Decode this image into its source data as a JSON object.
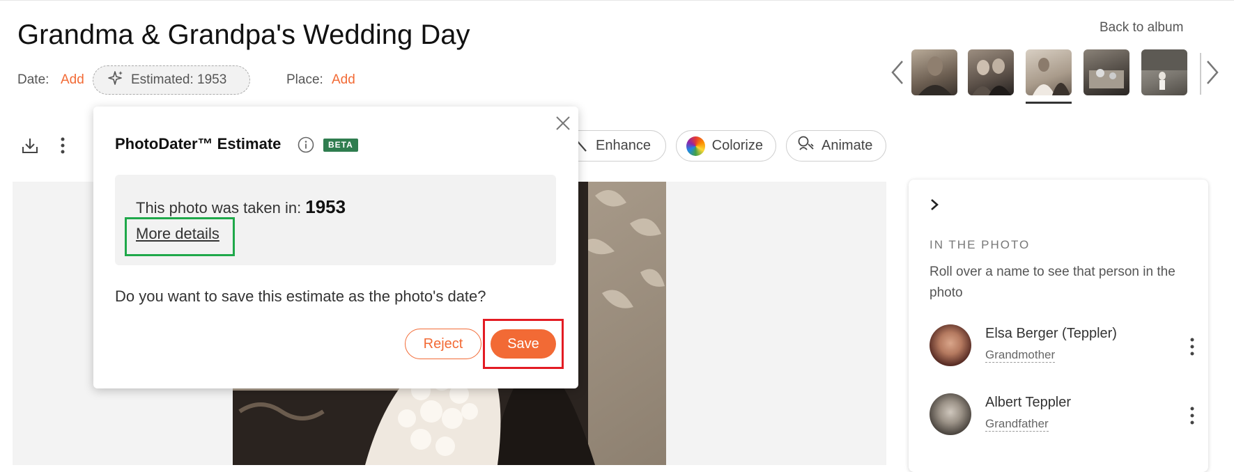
{
  "header": {
    "title": "Grandma & Grandpa's Wedding Day",
    "back_link": "Back to album",
    "date_label": "Date:",
    "date_add": "Add",
    "estimated_chip": "Estimated: 1953",
    "place_label": "Place:",
    "place_add": "Add"
  },
  "toolbar": {
    "enhance": "Enhance",
    "colorize": "Colorize",
    "animate": "Animate"
  },
  "popup": {
    "title": "PhotoDater™ Estimate",
    "badge": "BETA",
    "taken_text": "This photo was taken in:",
    "year": "1953",
    "more_details": "More details",
    "question": "Do you want to save this estimate as the photo's date?",
    "reject": "Reject",
    "save": "Save"
  },
  "panel": {
    "heading": "IN THE PHOTO",
    "instruction": "Roll over a name to see that person in the photo",
    "people": [
      {
        "name": "Elsa Berger (Teppler)",
        "relation": "Grandmother"
      },
      {
        "name": "Albert Teppler",
        "relation": "Grandfather"
      }
    ]
  },
  "colors": {
    "accent": "#f26a35",
    "beta_badge": "#2f7d4f",
    "highlight_green": "#1fa84a",
    "highlight_red": "#e31b23"
  },
  "icons": [
    "sparkle-icon",
    "chevron-left-icon",
    "chevron-right-icon",
    "download-icon",
    "more-vertical-icon",
    "magic-wand-icon",
    "color-wheel-icon",
    "animate-icon",
    "close-icon",
    "info-icon"
  ]
}
